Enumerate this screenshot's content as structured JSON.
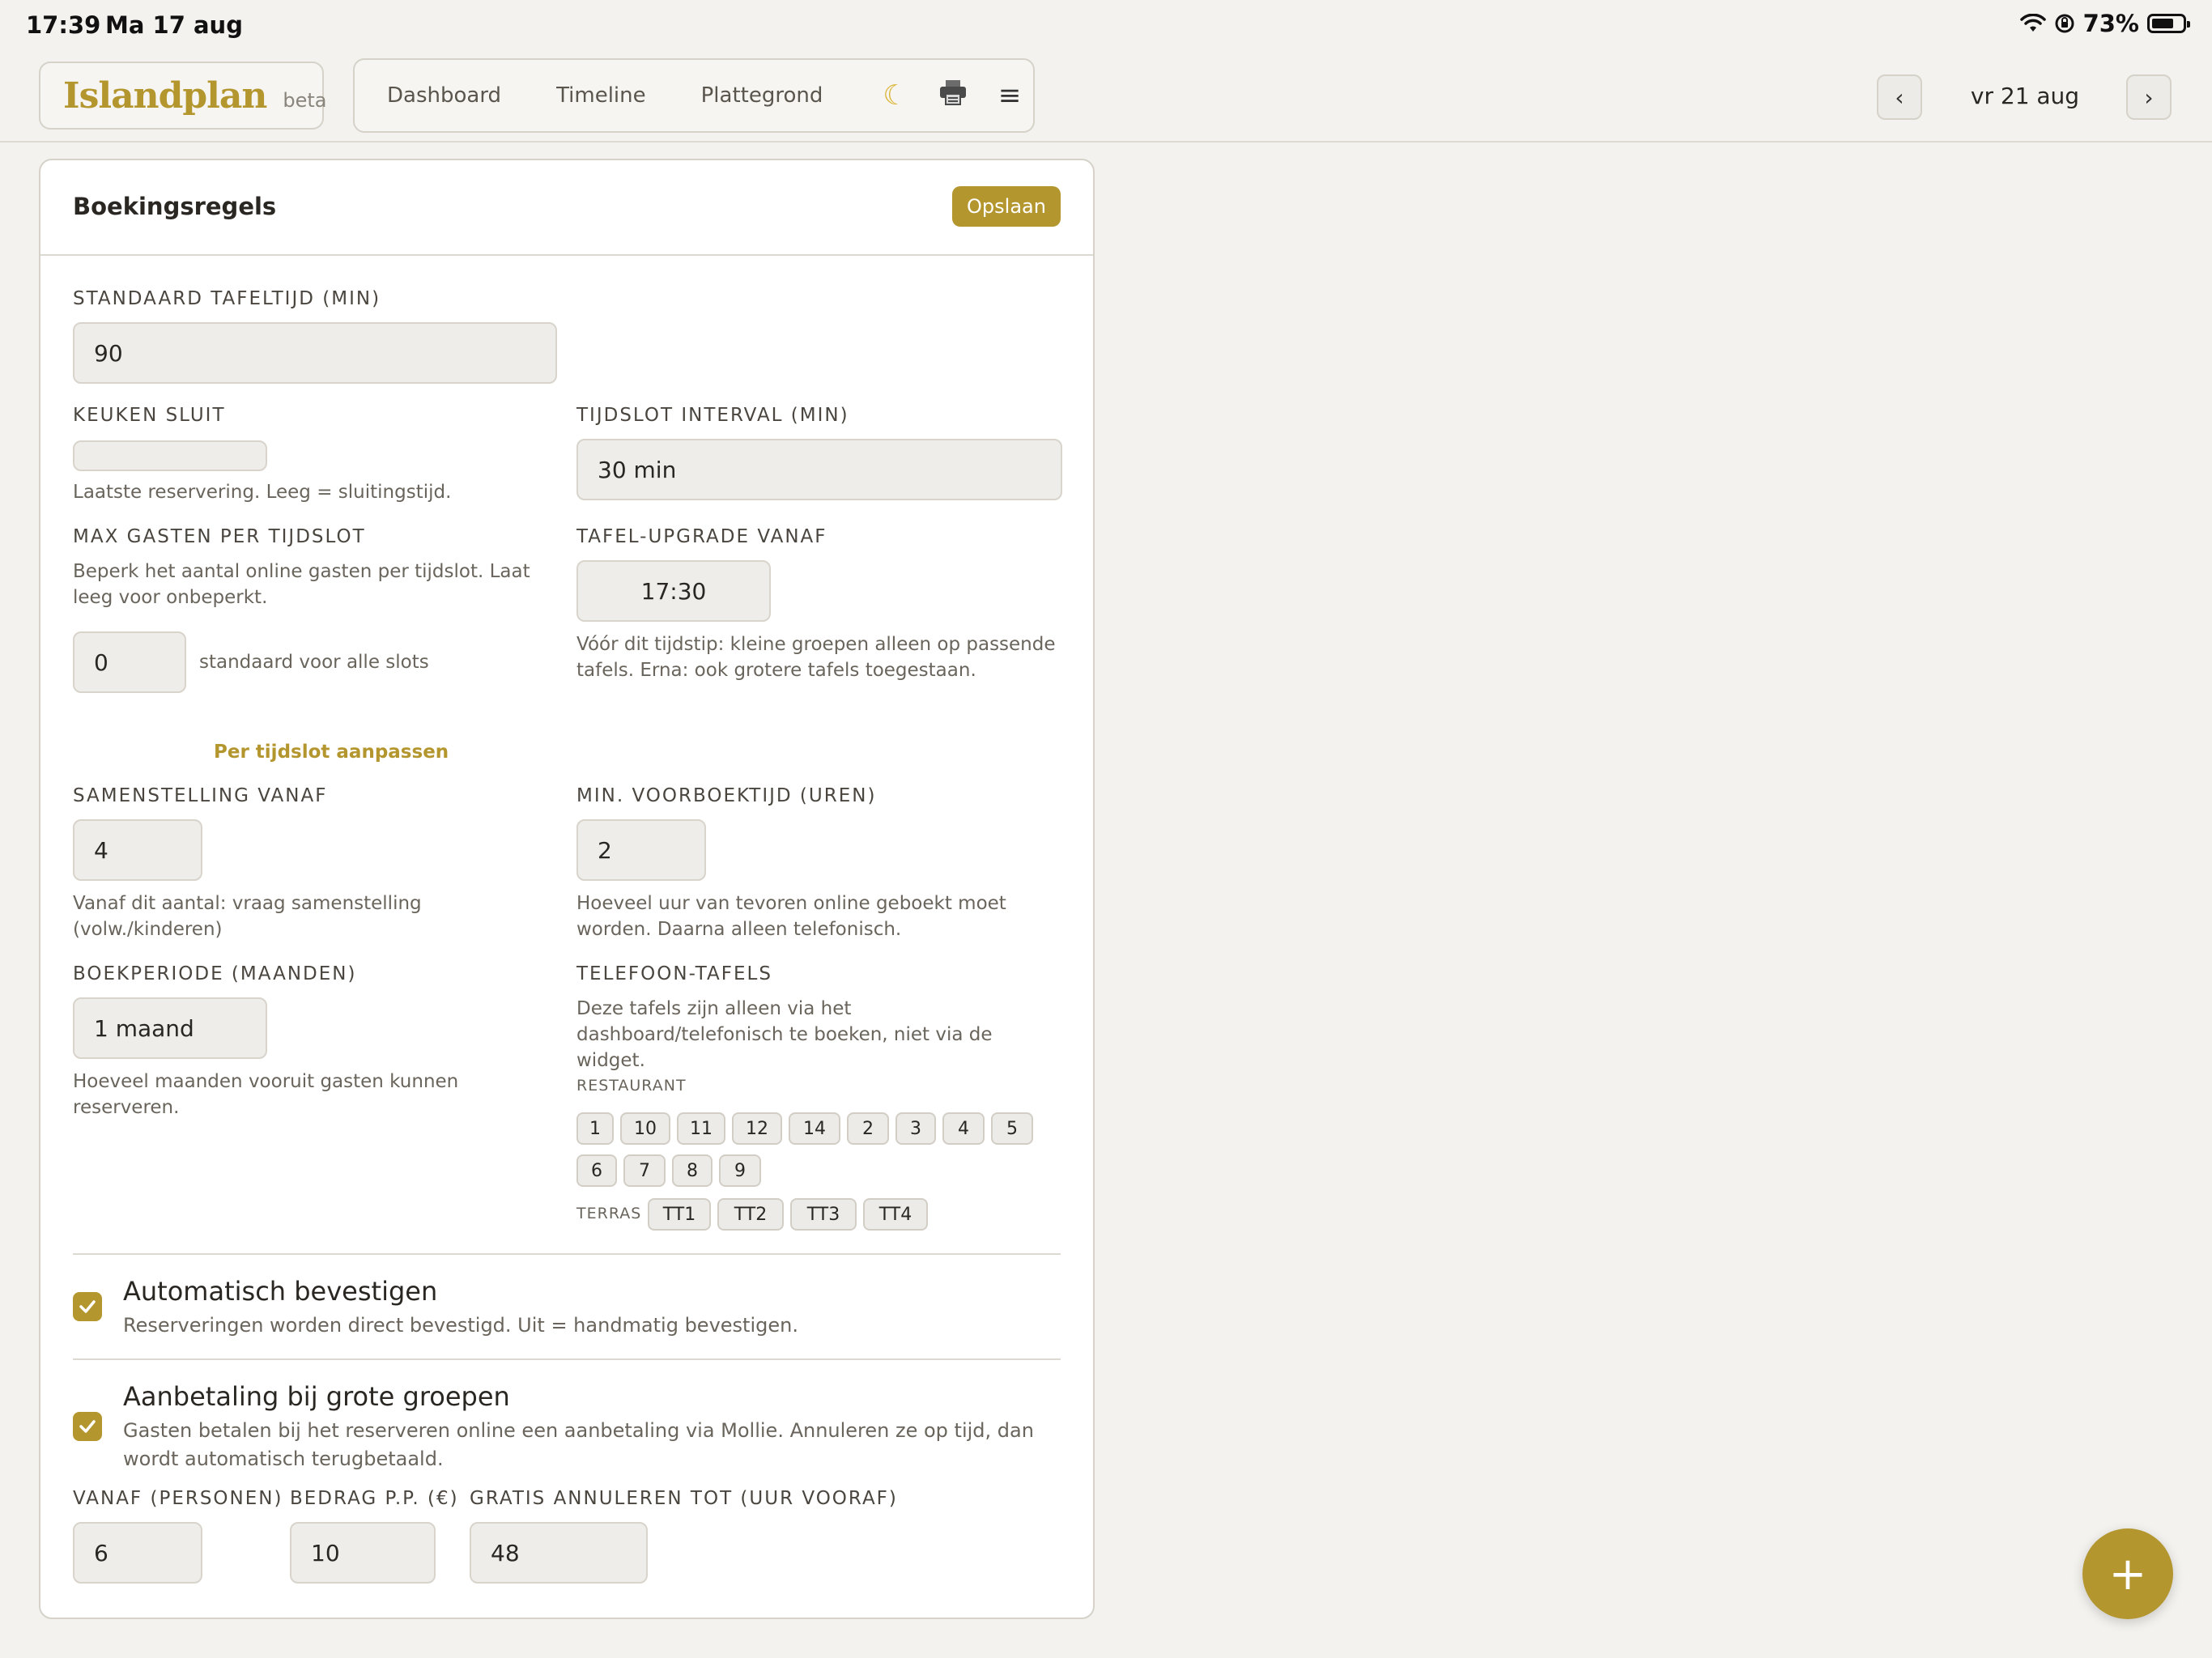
{
  "status_bar": {
    "time": "17:39",
    "date": "Ma 17 aug",
    "battery": "73%"
  },
  "header": {
    "logo": "Islandplan",
    "badge": "beta",
    "nav": [
      "Dashboard",
      "Timeline",
      "Plattegrond"
    ],
    "icons": [
      "moon-icon",
      "printer-icon",
      "menu-icon"
    ],
    "date_prev": "‹",
    "date": "vr 21 aug",
    "date_next": "›"
  },
  "card": {
    "title": "Boekingsregels",
    "save_label": "Opslaan",
    "standaard_tafeltijd": {
      "label": "STANDAARD TAFELTIJD (MIN)",
      "value": "90"
    },
    "keuken_sluit": {
      "label": "KEUKEN SLUIT",
      "value": "",
      "help": "Laatste reservering. Leeg = sluitingstijd."
    },
    "tijdslot_interval": {
      "label": "TIJDSLOT INTERVAL (MIN)",
      "value": "30 min"
    },
    "max_gasten": {
      "label": "MAX GASTEN PER TIJDSLOT",
      "help": "Beperk het aantal online gasten per tijdslot. Laat leeg voor onbeperkt.",
      "value": "0",
      "suffix": "standaard voor alle slots",
      "link": "Per tijdslot aanpassen"
    },
    "tafel_upgrade": {
      "label": "TAFEL-UPGRADE VANAF",
      "value": "17:30",
      "help": "Vóór dit tijdstip: kleine groepen alleen op passende tafels. Erna: ook grotere tafels toegestaan."
    },
    "samenstelling": {
      "label": "SAMENSTELLING VANAF",
      "value": "4",
      "help": "Vanaf dit aantal: vraag samenstelling (volw./kinderen)"
    },
    "min_voorboektijd": {
      "label": "MIN. VOORBOEKTIJD (UREN)",
      "value": "2",
      "help": "Hoeveel uur van tevoren online geboekt moet worden. Daarna alleen telefonisch."
    },
    "boekperiode": {
      "label": "BOEKPERIODE (MAANDEN)",
      "value": "1 maand",
      "help": "Hoeveel maanden vooruit gasten kunnen reserveren."
    },
    "telefoon_tafels": {
      "label": "TELEFOON-TAFELS",
      "help": "Deze tafels zijn alleen via het dashboard/telefonisch te boeken, niet via de widget.",
      "restaurant_label": "RESTAURANT",
      "restaurant": [
        "1",
        "10",
        "11",
        "12",
        "14",
        "2",
        "3",
        "4",
        "5",
        "6",
        "7",
        "8",
        "9"
      ],
      "terras_label": "TERRAS",
      "terras": [
        "TT1",
        "TT2",
        "TT3",
        "TT4"
      ]
    },
    "auto_bevestigen": {
      "title": "Automatisch bevestigen",
      "help": "Reserveringen worden direct bevestigd. Uit = handmatig bevestigen.",
      "checked": true
    },
    "aanbetaling": {
      "title": "Aanbetaling bij grote groepen",
      "help": "Gasten betalen bij het reserveren online een aanbetaling via Mollie. Annuleren ze op tijd, dan wordt automatisch terugbetaald.",
      "checked": true,
      "vanaf": {
        "label": "VANAF (PERSONEN)",
        "value": "6"
      },
      "bedrag": {
        "label": "BEDRAG P.P. (€)",
        "value": "10"
      },
      "gratis": {
        "label": "GRATIS ANNULEREN TOT (UUR VOORAF)",
        "value": "48"
      }
    }
  },
  "fab_label": "+",
  "colors": {
    "accent": "#b4962e",
    "background": "#f3f2ef",
    "card": "#ffffff",
    "input": "#efedea"
  }
}
